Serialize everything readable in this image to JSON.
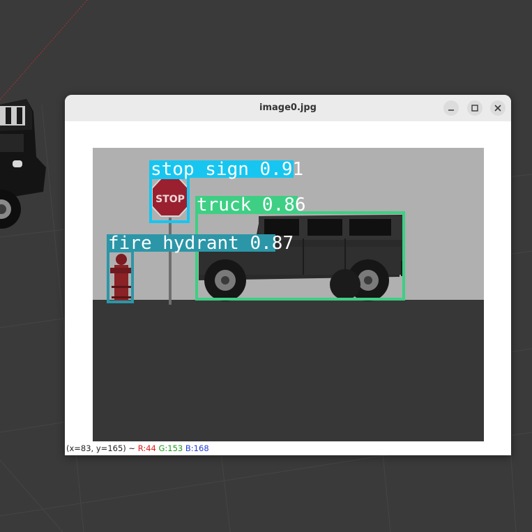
{
  "window": {
    "title": "image0.jpg"
  },
  "title_buttons": {
    "minimize_icon": "minimize-icon",
    "maximize_icon": "maximize-icon",
    "close_icon": "close-icon"
  },
  "detections": [
    {
      "label": "stop sign 0.91",
      "class": "stop sign",
      "confidence": 0.91,
      "color": "#16c6f0"
    },
    {
      "label": "truck 0.86",
      "class": "truck",
      "confidence": 0.86,
      "color": "#3ecf84"
    },
    {
      "label": "fire hydrant 0.87",
      "class": "fire hydrant",
      "confidence": 0.87,
      "color": "#2b96a8"
    }
  ],
  "status": {
    "coords": "(x=83, y=165) ~ ",
    "r": "R:44",
    "g": "G:153",
    "b": "B:168"
  },
  "colors": {
    "background": "#3a3a3a",
    "sky": "#b0b0b0",
    "ground": "#373737"
  }
}
